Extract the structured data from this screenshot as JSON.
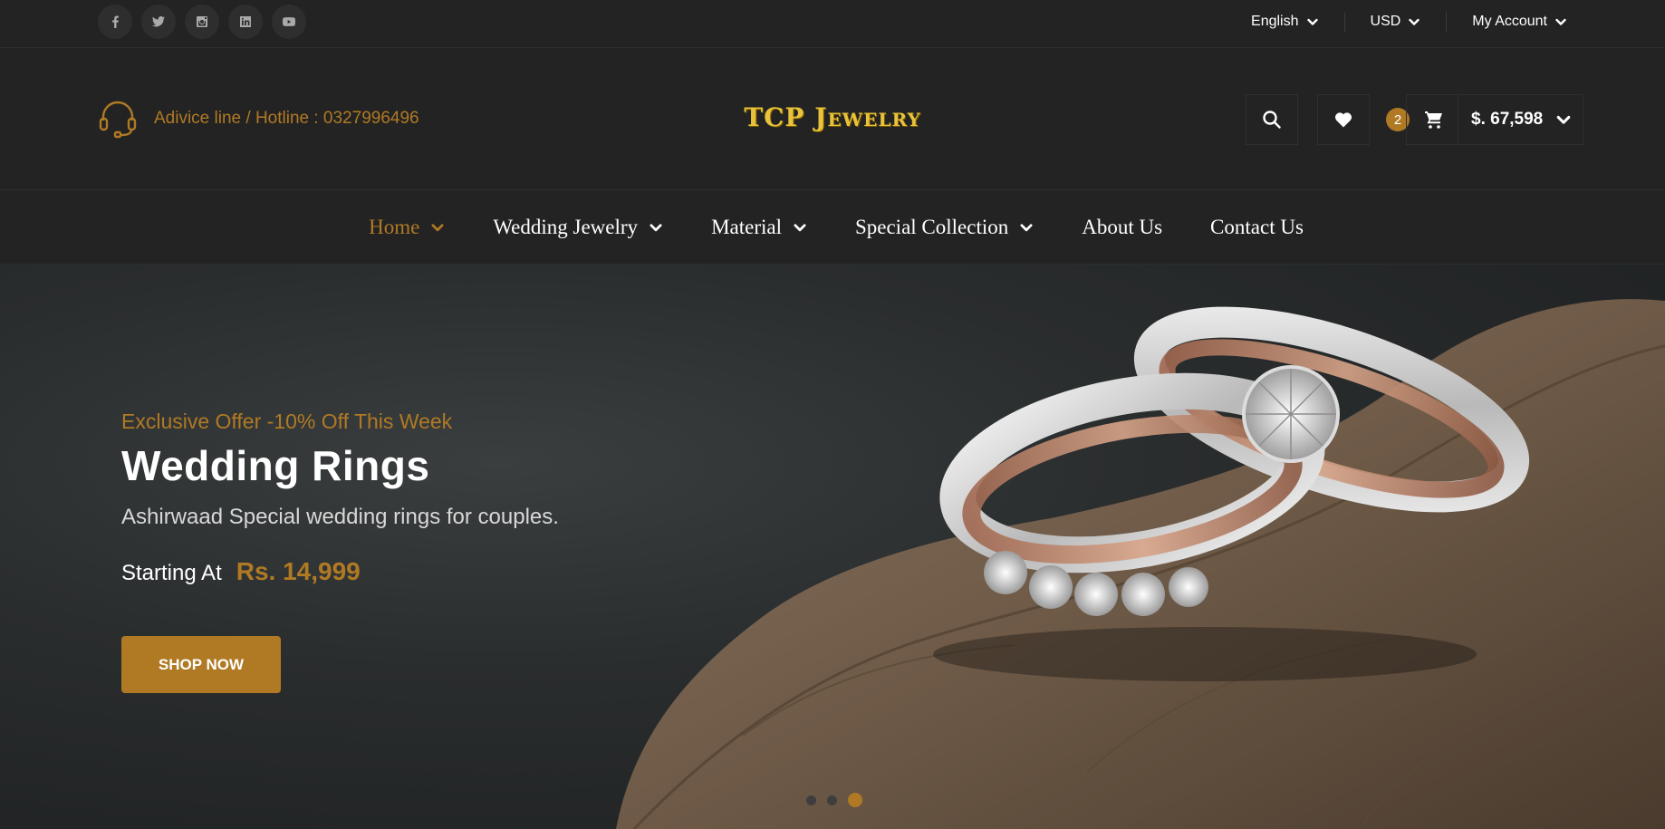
{
  "topbar": {
    "socials": [
      {
        "icon": "facebook-icon"
      },
      {
        "icon": "twitter-icon"
      },
      {
        "icon": "instagram-icon"
      },
      {
        "icon": "linkedin-icon"
      },
      {
        "icon": "youtube-icon"
      }
    ],
    "language": "English",
    "currency": "USD",
    "account": "My Account"
  },
  "header": {
    "hotline": "Adivice line / Hotline : 0327996496",
    "logo": "TCP Jewelry",
    "cart_count": "2",
    "cart_total": "$. 67,598"
  },
  "nav": {
    "items": [
      {
        "label": "Home"
      },
      {
        "label": "Wedding Jewelry"
      },
      {
        "label": "Material"
      },
      {
        "label": "Special Collection"
      },
      {
        "label": "About Us"
      },
      {
        "label": "Contact Us"
      }
    ]
  },
  "hero": {
    "offer": "Exclusive Offer -10% Off This Week",
    "title": "Wedding Rings",
    "subtitle": "Ashirwaad Special wedding rings for couples.",
    "starting_label": "Starting At",
    "price": "Rs. 14,999",
    "cta": "SHOP NOW",
    "slide_count": 3,
    "active_slide": 3
  },
  "colors": {
    "accent": "#b07a24",
    "background": "#232323",
    "logo": "#e8c23a"
  }
}
